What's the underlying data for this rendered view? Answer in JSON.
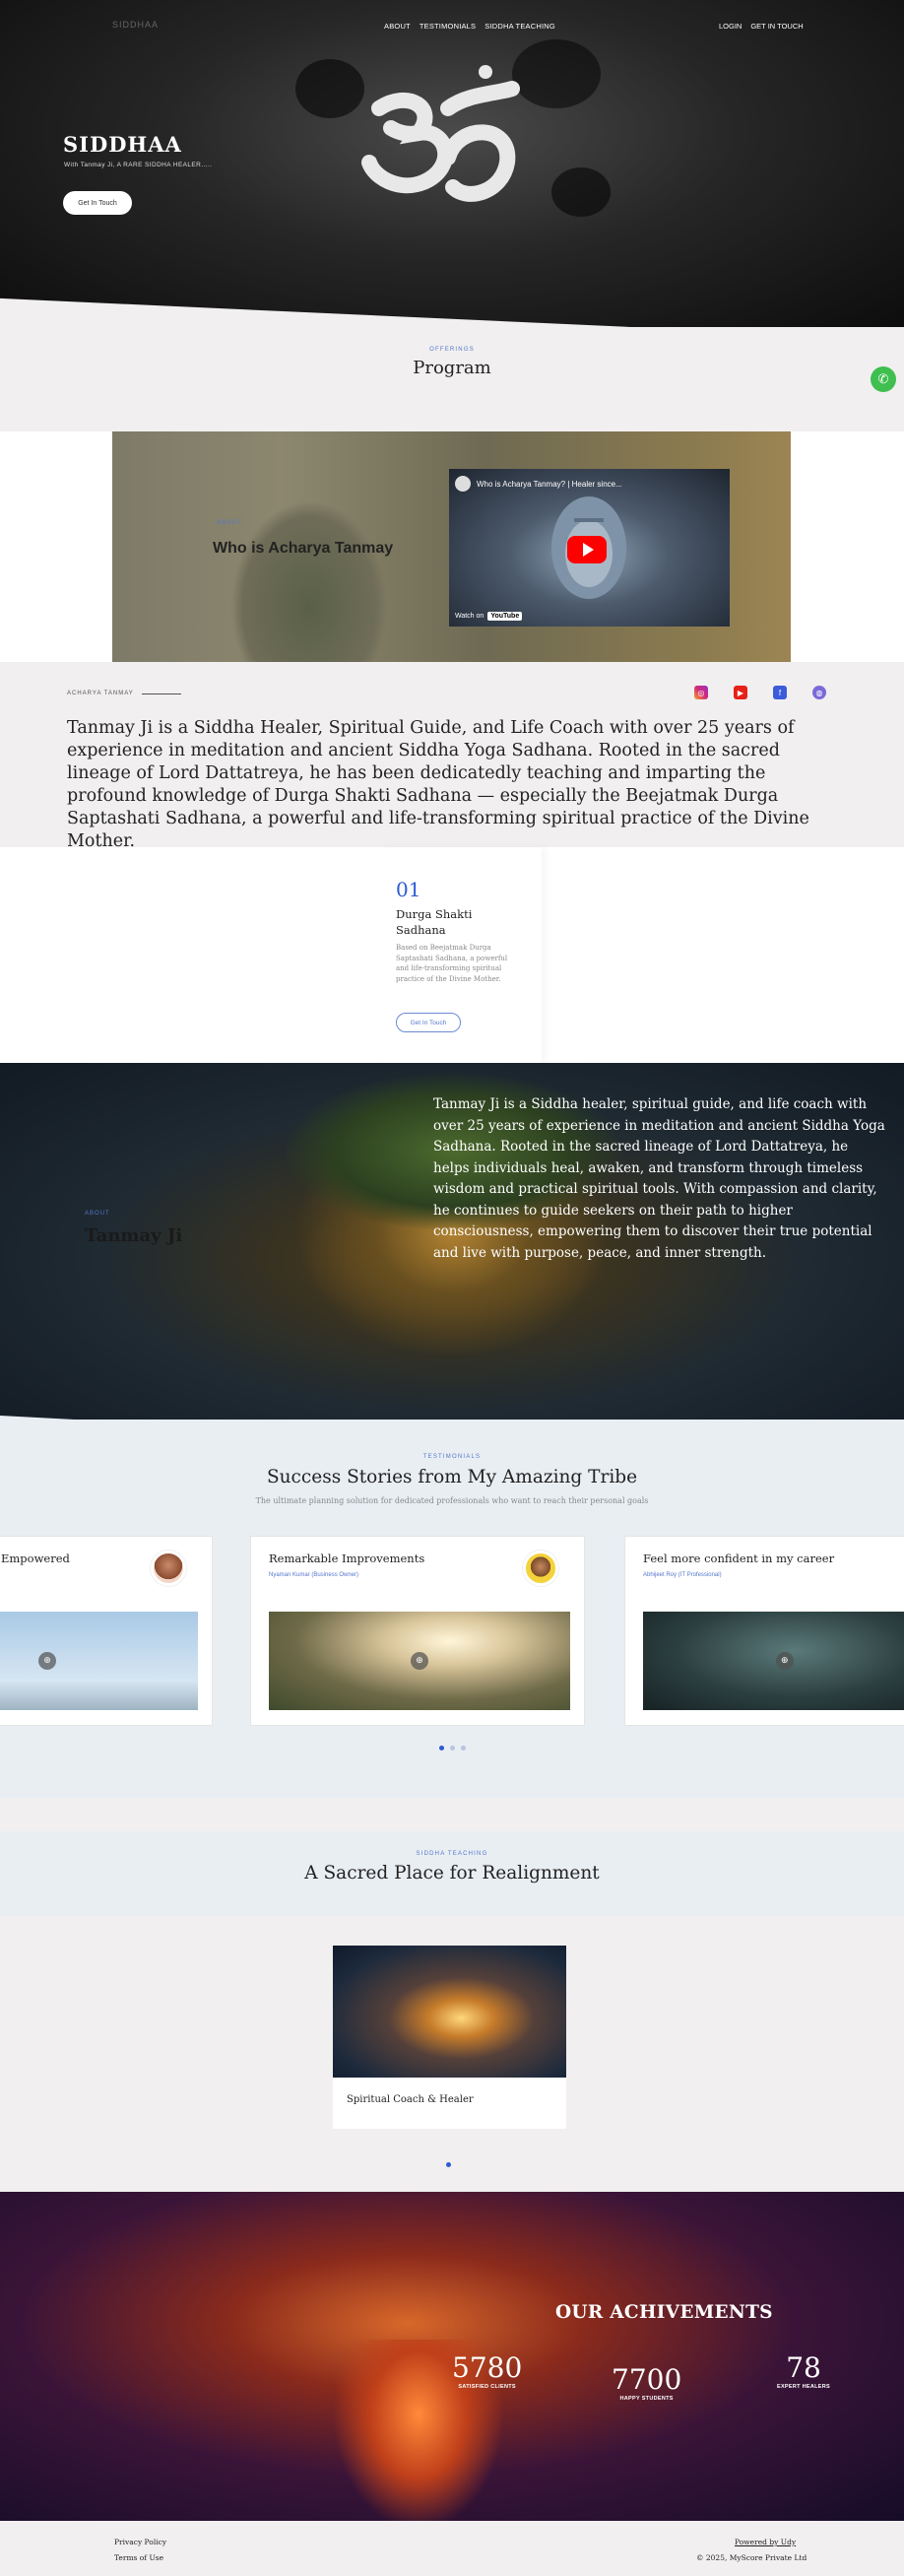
{
  "nav": {
    "logo_text": "SIDDHAA",
    "center_links": [
      "ABOUT",
      "TESTIMONIALS",
      "SIDDHA TEACHING"
    ],
    "right_links": [
      "LOGIN",
      "GET IN TOUCH"
    ]
  },
  "hero": {
    "title": "SIDDHAA",
    "subtitle": "With Tanmay Ji, A RARE SIDDHA HEALER.....",
    "button": "Get In Touch"
  },
  "program": {
    "eyebrow": "OFFERINGS",
    "title": "Program"
  },
  "video": {
    "eyebrow": "ABOUT",
    "title": "Who is Acharya Tanmay",
    "yt_title": "Who is Acharya Tanmay? | Healer since...",
    "yt_watch": "Watch on",
    "yt_logo": "YouTube"
  },
  "about": {
    "label": "ACHARYA TANMAY",
    "text": "Tanmay Ji is a Siddha Healer, Spiritual Guide, and Life Coach with over 25 years of experience in meditation and ancient Siddha Yoga Sadhana. Rooted in the sacred lineage of Lord Dattatreya, he has been dedicatedly teaching and imparting the profound knowledge of Durga Shakti Sadhana — especially the Beejatmak Durga Saptashati Sadhana, a powerful and life-transforming spiritual practice of the Divine Mother.",
    "socials": [
      "instagram-icon",
      "youtube-icon",
      "facebook-icon",
      "web-icon"
    ]
  },
  "program_card": {
    "number": "01",
    "title": "Durga Shakti Sadhana",
    "description": "Based on Beejatmak Durga Saptashati Sadhana, a powerful and life-transforming spiritual practice of the Divine Mother.",
    "button": "Get In Touch"
  },
  "tree": {
    "eyebrow": "ABOUT",
    "name": "Tanmay Ji",
    "text": "Tanmay Ji is a Siddha healer, spiritual guide, and life coach with over 25 years of experience in meditation and ancient Siddha Yoga Sadhana. Rooted in the sacred lineage of Lord Dattatreya, he helps individuals heal, awaken, and transform through timeless wisdom and practical spiritual tools. With compassion and clarity, he continues to guide seekers on their path to higher consciousness, empowering them to discover their true potential and live with purpose, peace, and inner strength."
  },
  "testimonials": {
    "eyebrow": "TESTIMONIALS",
    "title": "Success Stories from My Amazing Tribe",
    "subtitle": "The ultimate planning solution for dedicated professionals who want to reach their personal goals",
    "cards": [
      {
        "title": "Empowered",
        "by": ""
      },
      {
        "title": "Remarkable Improvements",
        "by": "Nyaman Kumar (Business Owner)"
      },
      {
        "title": "Feel more confident in my career",
        "by": "Abhijeet Roy (IT Professional)"
      }
    ]
  },
  "teaching": {
    "eyebrow": "SIDDHA TEACHING",
    "title": "A Sacred Place for Realignment",
    "card_title": "Spiritual Coach & Healer"
  },
  "achievements": {
    "title": "OUR ACHIVEMENTS",
    "stats": [
      {
        "value": "5780",
        "label": "SATISFIED CLIENTS"
      },
      {
        "value": "7700",
        "label": "HAPPY STUDENTS"
      },
      {
        "value": "78",
        "label": "EXPERT HEALERS"
      }
    ]
  },
  "footer": {
    "privacy": "Privacy Policy",
    "terms": "Terms of Use",
    "powered": "Powered by Udy",
    "copyright": "© 2025, MyScore Private Ltd"
  }
}
